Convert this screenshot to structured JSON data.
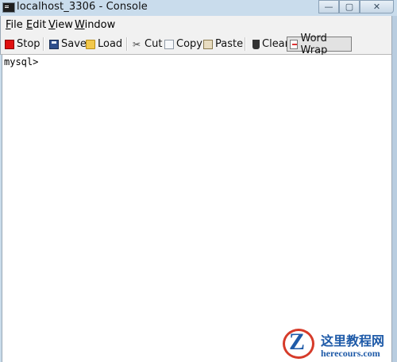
{
  "window": {
    "title": "localhost_3306 - Console"
  },
  "title_buttons": {
    "minimize": "—",
    "maximize": "▢",
    "close": "✕"
  },
  "menu": [
    {
      "mnemonic": "F",
      "rest": "ile"
    },
    {
      "mnemonic": "E",
      "rest": "dit"
    },
    {
      "mnemonic": "V",
      "rest": "iew"
    },
    {
      "mnemonic": "W",
      "rest": "indow"
    }
  ],
  "toolbar": {
    "stop": "Stop",
    "save": "Save",
    "load": "Load",
    "cut": "Cut",
    "copy": "Copy",
    "paste": "Paste",
    "clear": "Clear",
    "word_wrap": "Word Wrap"
  },
  "console": {
    "prompt": "mysql>"
  },
  "watermark": {
    "cn": "这里教程网",
    "url": "herecours.com"
  },
  "colors": {
    "stop_icon": "#e01010",
    "watermark_blue": "#1e5aa8",
    "watermark_red": "#d63b2a"
  }
}
